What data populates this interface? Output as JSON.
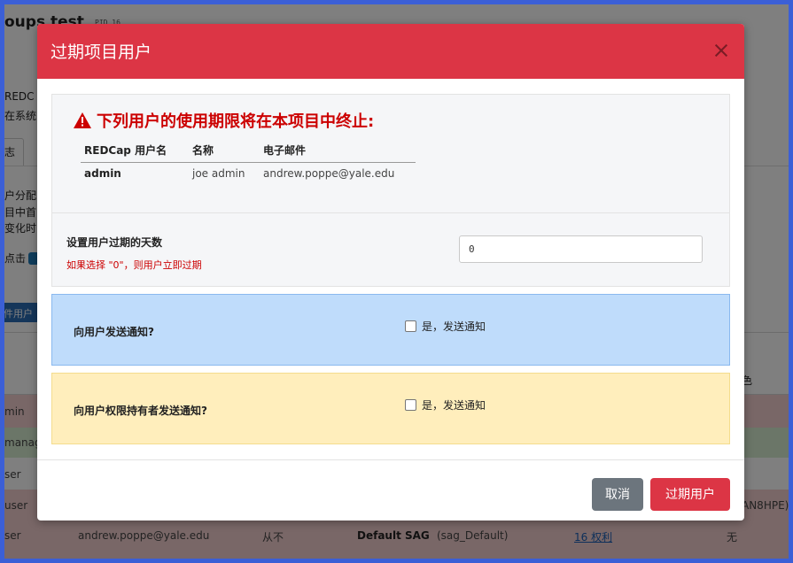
{
  "background": {
    "title": "oups test",
    "pid": "PID 16",
    "fragments": [
      "REDC",
      "在系统",
      "志",
      "户分配",
      "目中首",
      "变化时",
      "点击",
      "件用户",
      "色"
    ],
    "rows": [
      {
        "role": "min"
      },
      {
        "role": "manag"
      },
      {
        "role": "ser"
      },
      {
        "role": "user",
        "extra": "AN8HPE)"
      },
      {
        "role": "ser",
        "email": "andrew.poppe@yale.edu",
        "expiry": "从不",
        "group": "Default SAG",
        "group_id": "(sag_Default)",
        "rights": "16 权利",
        "none": "无"
      }
    ]
  },
  "modal": {
    "title": "过期项目用户",
    "warning": "下列用户的使用期限将在本项目中终止:",
    "table": {
      "headers": [
        "REDCap 用户名",
        "名称",
        "电子邮件"
      ],
      "rows": [
        {
          "username": "admin",
          "name": "joe admin",
          "email": "andrew.poppe@yale.edu"
        }
      ]
    },
    "days": {
      "label": "设置用户过期的天数",
      "hint": "如果选择 \"0\"，则用户立即过期",
      "value": "0"
    },
    "notify_users": {
      "question": "向用户发送通知?",
      "checkbox_label": "是，发送通知",
      "checked": false
    },
    "notify_owners": {
      "question": "向用户权限持有者发送通知?",
      "checkbox_label": "是，发送通知",
      "checked": false
    },
    "cancel_label": "取消",
    "expire_label": "过期用户"
  },
  "colors": {
    "header": "#dc3545",
    "notify_panel": "#bfdcfb",
    "owner_panel": "#ffeebc",
    "frame": "#3b5fd6"
  }
}
